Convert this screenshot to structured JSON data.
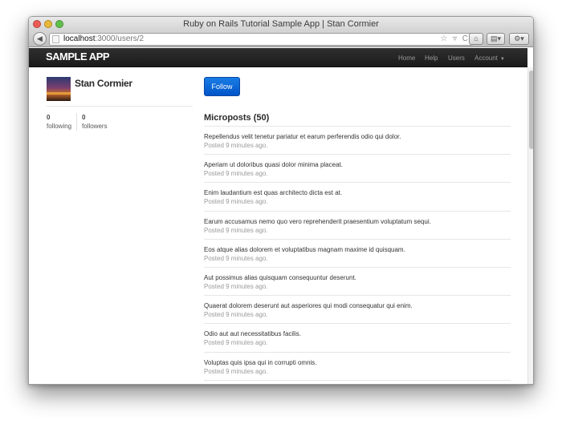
{
  "window": {
    "title": "Ruby on Rails Tutorial Sample App | Stan Cormier"
  },
  "browser": {
    "url_host": "localhost",
    "url_rest": ":3000/users/2",
    "url_tools": "☆ ▿ C",
    "back_icon": "back-arrow-icon",
    "home_icon": "home-icon",
    "sidebar_icon": "sidebar-icon",
    "tools_icon": "tools-icon"
  },
  "nav": {
    "logo": "SAMPLE APP",
    "items": [
      {
        "label": "Home"
      },
      {
        "label": "Help"
      },
      {
        "label": "Users"
      },
      {
        "label": "Account"
      }
    ]
  },
  "user": {
    "name": "Stan Cormier",
    "following_count": "0",
    "following_label": "following",
    "followers_count": "0",
    "followers_label": "followers"
  },
  "actions": {
    "follow_label": "Follow"
  },
  "microposts": {
    "title": "Microposts (50)",
    "items": [
      {
        "content": "Repellendus velit tenetur pariatur et earum perferendis odio qui dolor.",
        "time": "Posted 9 minutes ago."
      },
      {
        "content": "Aperiam ut doloribus quasi dolor minima placeat.",
        "time": "Posted 9 minutes ago."
      },
      {
        "content": "Enim laudantium est quas architecto dicta est at.",
        "time": "Posted 9 minutes ago."
      },
      {
        "content": "Earum accusamus nemo quo vero reprehenderit praesentium voluptatum sequi.",
        "time": "Posted 9 minutes ago."
      },
      {
        "content": "Eos atque alias dolorem et voluptatibus magnam maxime id quisquam.",
        "time": "Posted 9 minutes ago."
      },
      {
        "content": "Aut possimus alias quisquam consequuntur deserunt.",
        "time": "Posted 9 minutes ago."
      },
      {
        "content": "Quaerat dolorem deserunt aut asperiores qui modi consequatur qui enim.",
        "time": "Posted 9 minutes ago."
      },
      {
        "content": "Odio aut aut necessitatibus facilis.",
        "time": "Posted 9 minutes ago."
      },
      {
        "content": "Voluptas quis ipsa qui in corrupti omnis.",
        "time": "Posted 9 minutes ago."
      }
    ]
  },
  "colors": {
    "navbar": "#222222",
    "follow_button": "#0a6ad8",
    "muted_text": "#999999"
  }
}
